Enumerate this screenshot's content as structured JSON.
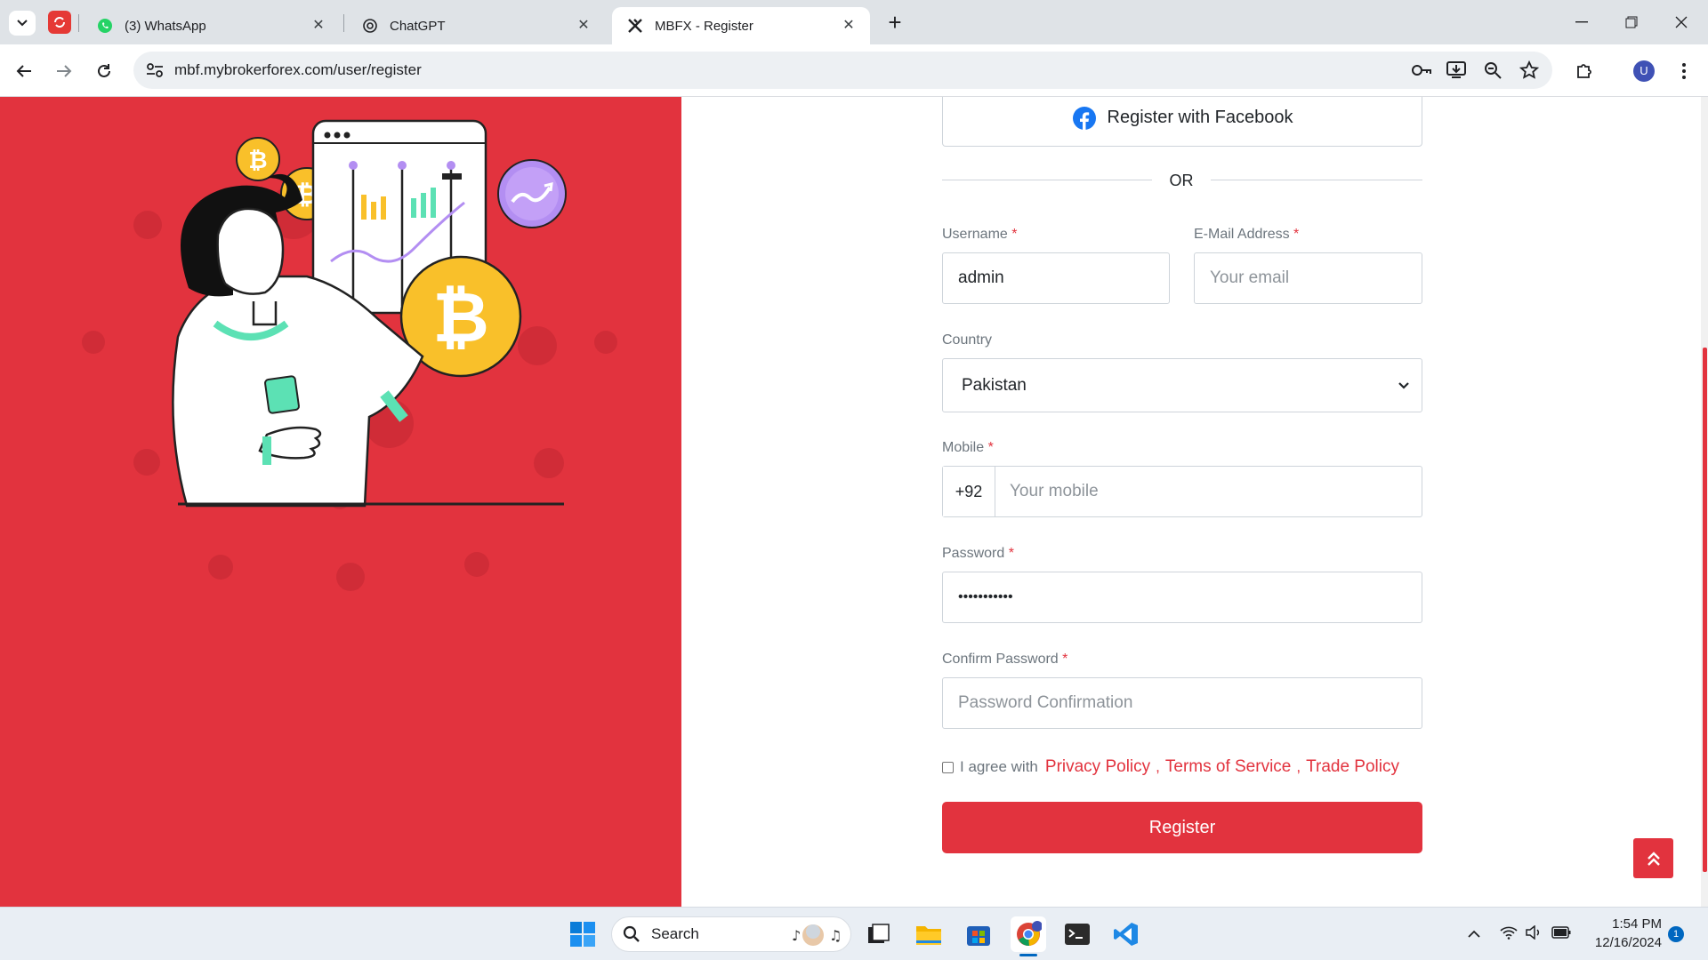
{
  "browser": {
    "tabs": [
      {
        "label": "(3) WhatsApp",
        "icon": "whatsapp-icon"
      },
      {
        "label": "ChatGPT",
        "icon": "chatgpt-icon"
      },
      {
        "label": "MBFX - Register",
        "icon": "mbfx-icon",
        "active": true
      }
    ],
    "new_tab_label": "+",
    "url": "mbf.mybrokerforex.com/user/register",
    "profile_initial": "U"
  },
  "form": {
    "facebook_button": "Register with Facebook",
    "divider": "OR",
    "username": {
      "label": "Username",
      "required": "*",
      "value": "admin"
    },
    "email": {
      "label": "E-Mail Address",
      "required": "*",
      "placeholder": "Your email"
    },
    "country": {
      "label": "Country",
      "value": "Pakistan"
    },
    "mobile": {
      "label": "Mobile",
      "required": "*",
      "prefix": "+92",
      "placeholder": "Your mobile"
    },
    "password": {
      "label": "Password",
      "required": "*",
      "value": "•••••••••••"
    },
    "confirm_password": {
      "label": "Confirm Password",
      "required": "*",
      "placeholder": "Password Confirmation"
    },
    "agree": {
      "text": "I agree with",
      "links": [
        "Privacy Policy",
        "Terms of Service",
        "Trade Policy"
      ],
      "sep": ","
    },
    "register_button": "Register"
  },
  "colors": {
    "brand": "#e2333e",
    "facebook": "#1877f2"
  },
  "taskbar": {
    "search_label": "Search",
    "time": "1:54 PM",
    "date": "12/16/2024",
    "notification_count": "1"
  }
}
